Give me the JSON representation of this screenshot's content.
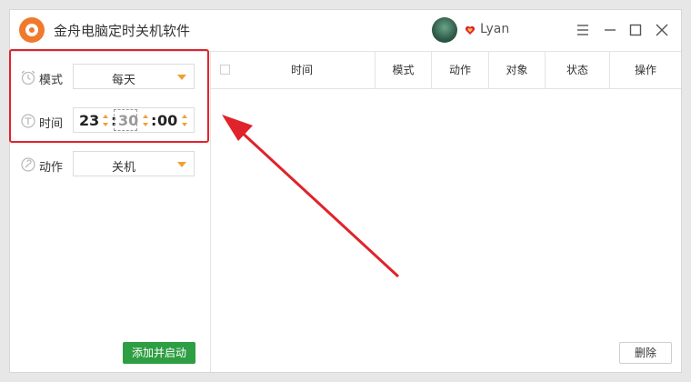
{
  "app": {
    "title": "金舟电脑定时关机软件",
    "username": "Lyan"
  },
  "sidebar": {
    "mode": {
      "label": "模式",
      "value": "每天"
    },
    "time": {
      "label": "时间",
      "hour": "23",
      "minute": "30",
      "second": "00"
    },
    "action": {
      "label": "动作",
      "value": "关机"
    },
    "add_button": "添加并启动"
  },
  "table": {
    "columns": [
      "时间",
      "模式",
      "动作",
      "对象",
      "状态",
      "操作"
    ],
    "rows": []
  },
  "delete_button": "删除",
  "colors": {
    "accent_orange": "#f0a030",
    "logo_orange": "#f07a2c",
    "add_green": "#2e9e42",
    "annotation_red": "#e0232b"
  },
  "icons": {
    "mode": "alarm-clock-icon",
    "time": "timer-icon",
    "action": "wrench-icon",
    "vip": "heart-badge-icon"
  }
}
